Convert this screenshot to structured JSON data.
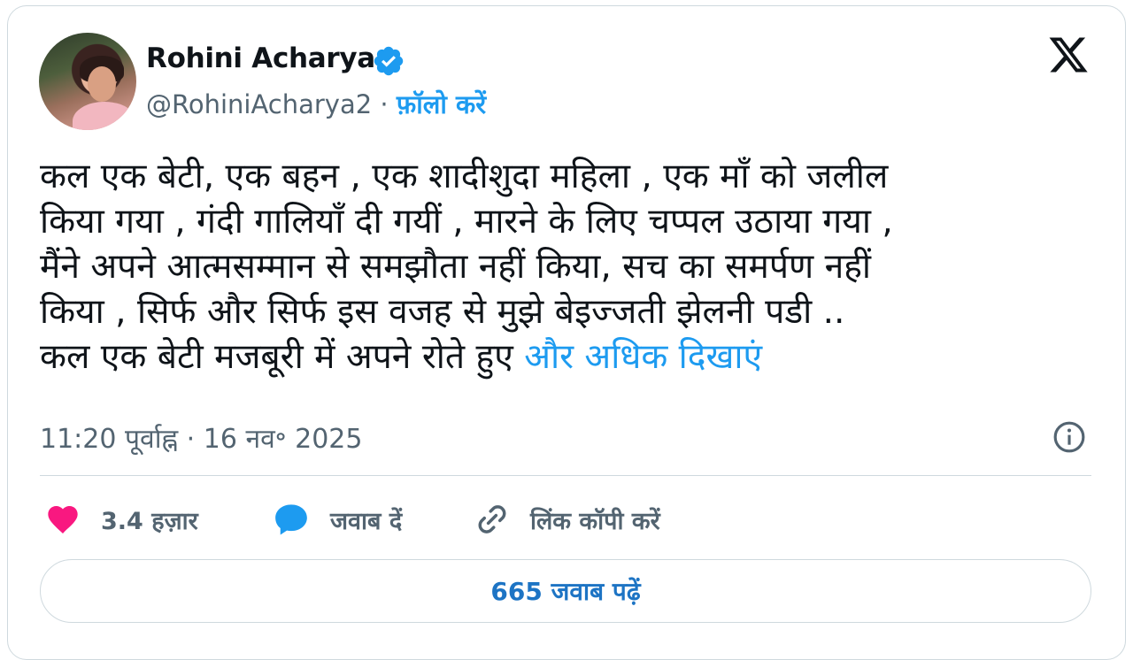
{
  "author": {
    "name": "Rohini Acharya",
    "handle": "@RohiniAcharya2",
    "separator": "·",
    "follow_label": "फ़ॉलो करें"
  },
  "tweet": {
    "lines": [
      "कल एक बेटी, एक बहन , एक शादीशुदा महिला , एक माँ को जलील",
      "किया गया , गंदी गालियाँ दी गयीं , मारने के लिए चप्पल उठाया गया ,",
      "मैंने  अपने आत्मसम्मान से समझौता नहीं किया, सच का समर्पण नहीं",
      "किया , सिर्फ और सिर्फ इस वजह से मुझे बेइज्जती झेलनी पडी ..",
      "कल एक बेटी मजबूरी में अपने रोते हुए"
    ],
    "show_more_label": "और अधिक दिखाएं",
    "timestamp": "11:20 पूर्वाह्न · 16 नव॰ 2025"
  },
  "actions": {
    "like_count": "3.4 हज़ार",
    "reply_label": "जवाब दें",
    "copy_link_label": "लिंक कॉपी करें"
  },
  "read_replies_label": "665 जवाब पढ़ें",
  "icons": {
    "verified": "verified-badge-icon",
    "brand": "x-logo-icon",
    "info": "info-icon",
    "like": "heart-icon",
    "reply": "reply-bubble-icon",
    "link": "link-icon"
  },
  "colors": {
    "accent": "#1d9bf0",
    "like": "#f91880",
    "secondary_text": "#536471",
    "border": "#cfd9de"
  }
}
